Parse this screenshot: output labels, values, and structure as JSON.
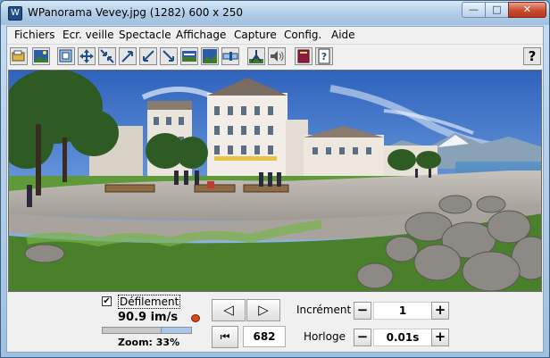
{
  "window": {
    "title": "WPanorama  Vevey.jpg   (1282) 600 x 250",
    "app_icon": "W"
  },
  "menu": [
    "Fichiers",
    "Ecr. veille",
    "Spectacle",
    "Affichage",
    "Capture",
    "Config.",
    "Aide"
  ],
  "toolbar": {
    "buttons": [
      "open-icon",
      "image-icon",
      "screen-icon",
      "move-icon",
      "shrink-icon",
      "expand-ne-icon",
      "shrink-sw-icon",
      "expand-se-icon",
      "fit-icon",
      "panorama-icon",
      "slider-icon",
      "tripod-icon",
      "sound-icon",
      "book-icon",
      "help-page-icon"
    ],
    "help_label": "?"
  },
  "controls": {
    "scroll_label": "Défilement",
    "scroll_checked": true,
    "checkmark": "✔",
    "speed": "90.9 im/s",
    "zoom_label": "Zoom: 33%",
    "zoom_fraction": 0.33,
    "frame_counter": "682",
    "increment_label": "Incrément",
    "increment_value": "1",
    "clock_label": "Horloge",
    "clock_value": "0.01s",
    "minus": "−",
    "plus": "+",
    "prev_glyph": "◁",
    "next_glyph": "▷",
    "first_glyph": "⏮"
  },
  "colors": {
    "sky": "#3f74c9",
    "lake": "#5f9ccf",
    "grass": "#5d9a3a",
    "path": "#b6b2ab"
  }
}
